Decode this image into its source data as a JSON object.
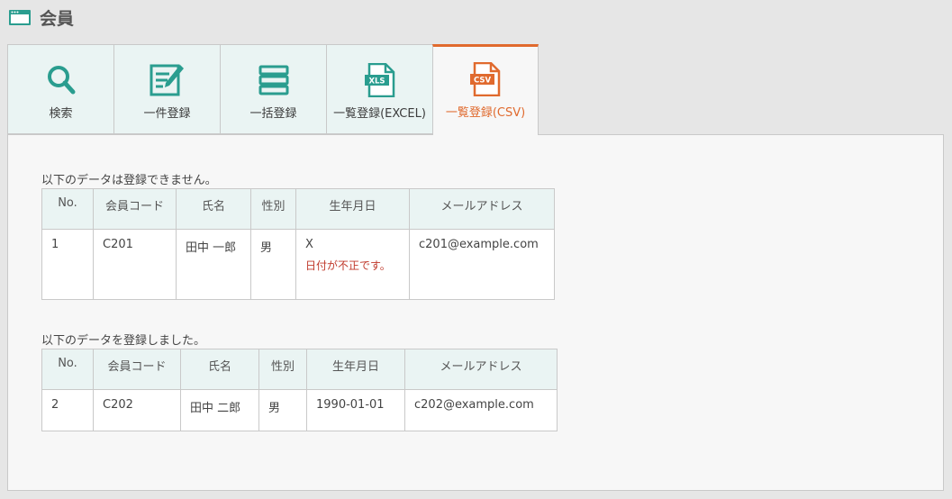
{
  "page": {
    "title": "会員"
  },
  "tabs": [
    {
      "label": "検索",
      "icon": "search-icon"
    },
    {
      "label": "一件登録",
      "icon": "edit-form-icon"
    },
    {
      "label": "一括登録",
      "icon": "list-icon"
    },
    {
      "label": "一覧登録(EXCEL)",
      "icon": "xls-file-icon"
    },
    {
      "label": "一覧登録(CSV)",
      "icon": "csv-file-icon",
      "active": true
    }
  ],
  "colors": {
    "accent": "#e06a2e",
    "teal": "#2a9d8f",
    "error": "#c0392b"
  },
  "failed": {
    "label": "以下のデータは登録できません。",
    "headers": [
      "No.",
      "会員コード",
      "氏名",
      "性別",
      "生年月日",
      "メールアドレス"
    ],
    "rows": [
      {
        "no": "1",
        "code": "C201",
        "name": "田中 一郎",
        "gender": "男",
        "birth": "X",
        "birth_error": "日付が不正です。",
        "email": "c201@example.com"
      }
    ]
  },
  "success": {
    "label": "以下のデータを登録しました。",
    "headers": [
      "No.",
      "会員コード",
      "氏名",
      "性別",
      "生年月日",
      "メールアドレス"
    ],
    "rows": [
      {
        "no": "2",
        "code": "C202",
        "name": "田中 二郎",
        "gender": "男",
        "birth": "1990-01-01",
        "email": "c202@example.com"
      }
    ]
  }
}
